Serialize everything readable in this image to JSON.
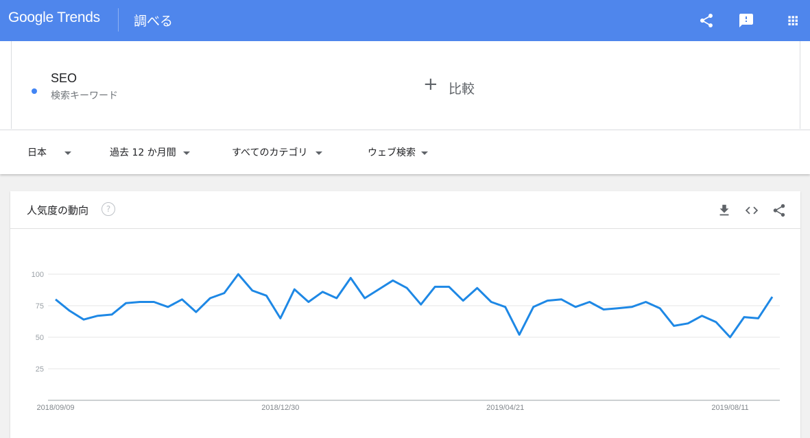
{
  "header": {
    "logo": "Google Trends",
    "title": "調べる",
    "icons": [
      "share-icon",
      "feedback-icon",
      "apps-grid-icon"
    ]
  },
  "search": {
    "term": "SEO",
    "term_type": "検索キーワード",
    "term_color": "#4285f4",
    "compare_label": "比較"
  },
  "filters": {
    "region": "日本",
    "period": "過去 12 か月間",
    "category": "すべてのカテゴリ",
    "search_type": "ウェブ検索"
  },
  "card": {
    "title": "人気度の動向",
    "help": "?",
    "icons": [
      "download-icon",
      "embed-code-icon",
      "share-icon"
    ]
  },
  "chart_data": {
    "type": "line",
    "title": "",
    "xlabel": "",
    "ylabel": "",
    "ylim": [
      0,
      100
    ],
    "yticks": [
      25,
      50,
      75,
      100
    ],
    "x_tick_labels": [
      "2018/09/09",
      "2018/12/30",
      "2019/04/21",
      "2019/08/11"
    ],
    "grid": true,
    "series": [
      {
        "color": "#1e88e5",
        "values": [
          80,
          71,
          64,
          67,
          68,
          77,
          78,
          78,
          74,
          80,
          70,
          81,
          85,
          100,
          87,
          83,
          65,
          88,
          78,
          86,
          81,
          97,
          81,
          88,
          95,
          89,
          76,
          90,
          90,
          79,
          89,
          78,
          74,
          52,
          74,
          79,
          80,
          74,
          78,
          72,
          73,
          74,
          78,
          73,
          59,
          61,
          67,
          62,
          50,
          66,
          65,
          82
        ]
      }
    ]
  }
}
